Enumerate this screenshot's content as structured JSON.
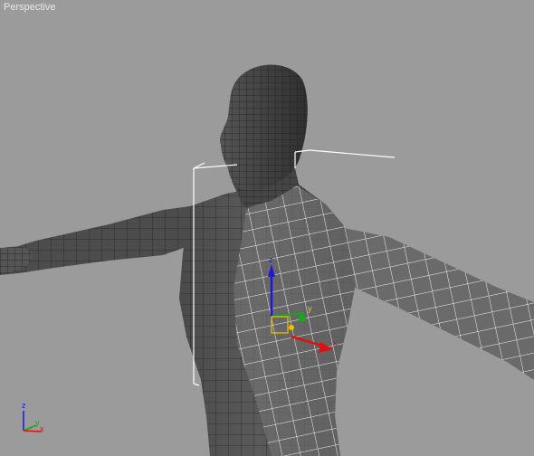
{
  "viewport": {
    "label": "Perspective",
    "background": "#9b9b9b"
  },
  "gizmo": {
    "x_label": "x",
    "y_label": "y",
    "z_label": "z",
    "colors": {
      "x": "#e01010",
      "y": "#17a817",
      "z": "#1a1ad8",
      "pivot": "#f0c000"
    }
  },
  "view_cube": {
    "x_label": "x",
    "y_label": "y",
    "z_label": "z"
  },
  "model": {
    "icon": "human-mesh-icon",
    "wire_color": "#ffffff",
    "mesh_dark": "#3a3a3a",
    "mesh_light": "#6a6a6a"
  },
  "selection_box": {
    "icon": "bounding-box-icon",
    "color": "#ffffff"
  }
}
